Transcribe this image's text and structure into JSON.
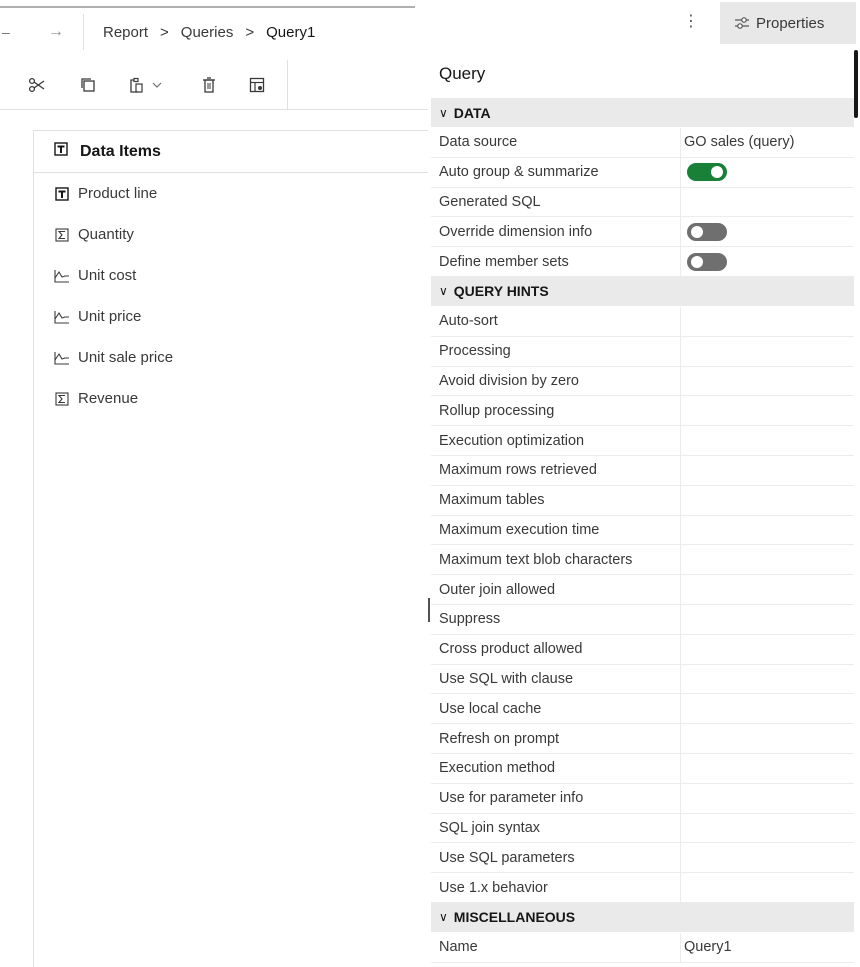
{
  "nav": {
    "back_symbol": "–",
    "forward_symbol": "→"
  },
  "breadcrumb": {
    "items": [
      "Report",
      "Queries"
    ],
    "current": "Query1",
    "separator": ">"
  },
  "header": {
    "kebab_symbol": "⋮",
    "properties_label": "Properties"
  },
  "toolbar": {
    "icons": [
      "cut-icon",
      "copy-icon",
      "paste-icon",
      "chevron-down-icon",
      "delete-icon",
      "data-item-editor-icon"
    ]
  },
  "data_items": {
    "header": "Data Items",
    "items": [
      {
        "label": "Product line",
        "icon": "attribute-icon"
      },
      {
        "label": "Quantity",
        "icon": "sum-icon"
      },
      {
        "label": "Unit cost",
        "icon": "measure-icon"
      },
      {
        "label": "Unit price",
        "icon": "measure-icon"
      },
      {
        "label": "Unit sale price",
        "icon": "measure-icon"
      },
      {
        "label": "Revenue",
        "icon": "sum-icon"
      }
    ]
  },
  "properties": {
    "title": "Query",
    "sections": {
      "data": {
        "label": "DATA",
        "rows": [
          {
            "key": "Data source",
            "value": "GO sales (query)"
          },
          {
            "key": "Auto group & summarize",
            "toggle": "on"
          },
          {
            "key": "Generated SQL",
            "value": ""
          },
          {
            "key": "Override dimension info",
            "toggle": "off"
          },
          {
            "key": "Define member sets",
            "toggle": "off"
          }
        ]
      },
      "query_hints": {
        "label": "QUERY HINTS",
        "rows": [
          "Auto-sort",
          "Processing",
          "Avoid division by zero",
          "Rollup processing",
          "Execution optimization",
          "Maximum rows retrieved",
          "Maximum tables",
          "Maximum execution time",
          "Maximum text blob characters",
          "Outer join allowed",
          "Suppress",
          "Cross product allowed",
          "Use SQL with clause",
          "Use local cache",
          "Refresh on prompt",
          "Execution method",
          "Use for parameter info",
          "SQL join syntax",
          "Use SQL parameters",
          "Use 1.x behavior"
        ]
      },
      "misc": {
        "label": "MISCELLANEOUS",
        "rows": [
          {
            "key": "Name",
            "value": "Query1"
          }
        ]
      }
    }
  },
  "colors": {
    "toggle_on": "#198038",
    "toggle_off": "#6f6f6f",
    "section_bg": "#eaeaea"
  }
}
